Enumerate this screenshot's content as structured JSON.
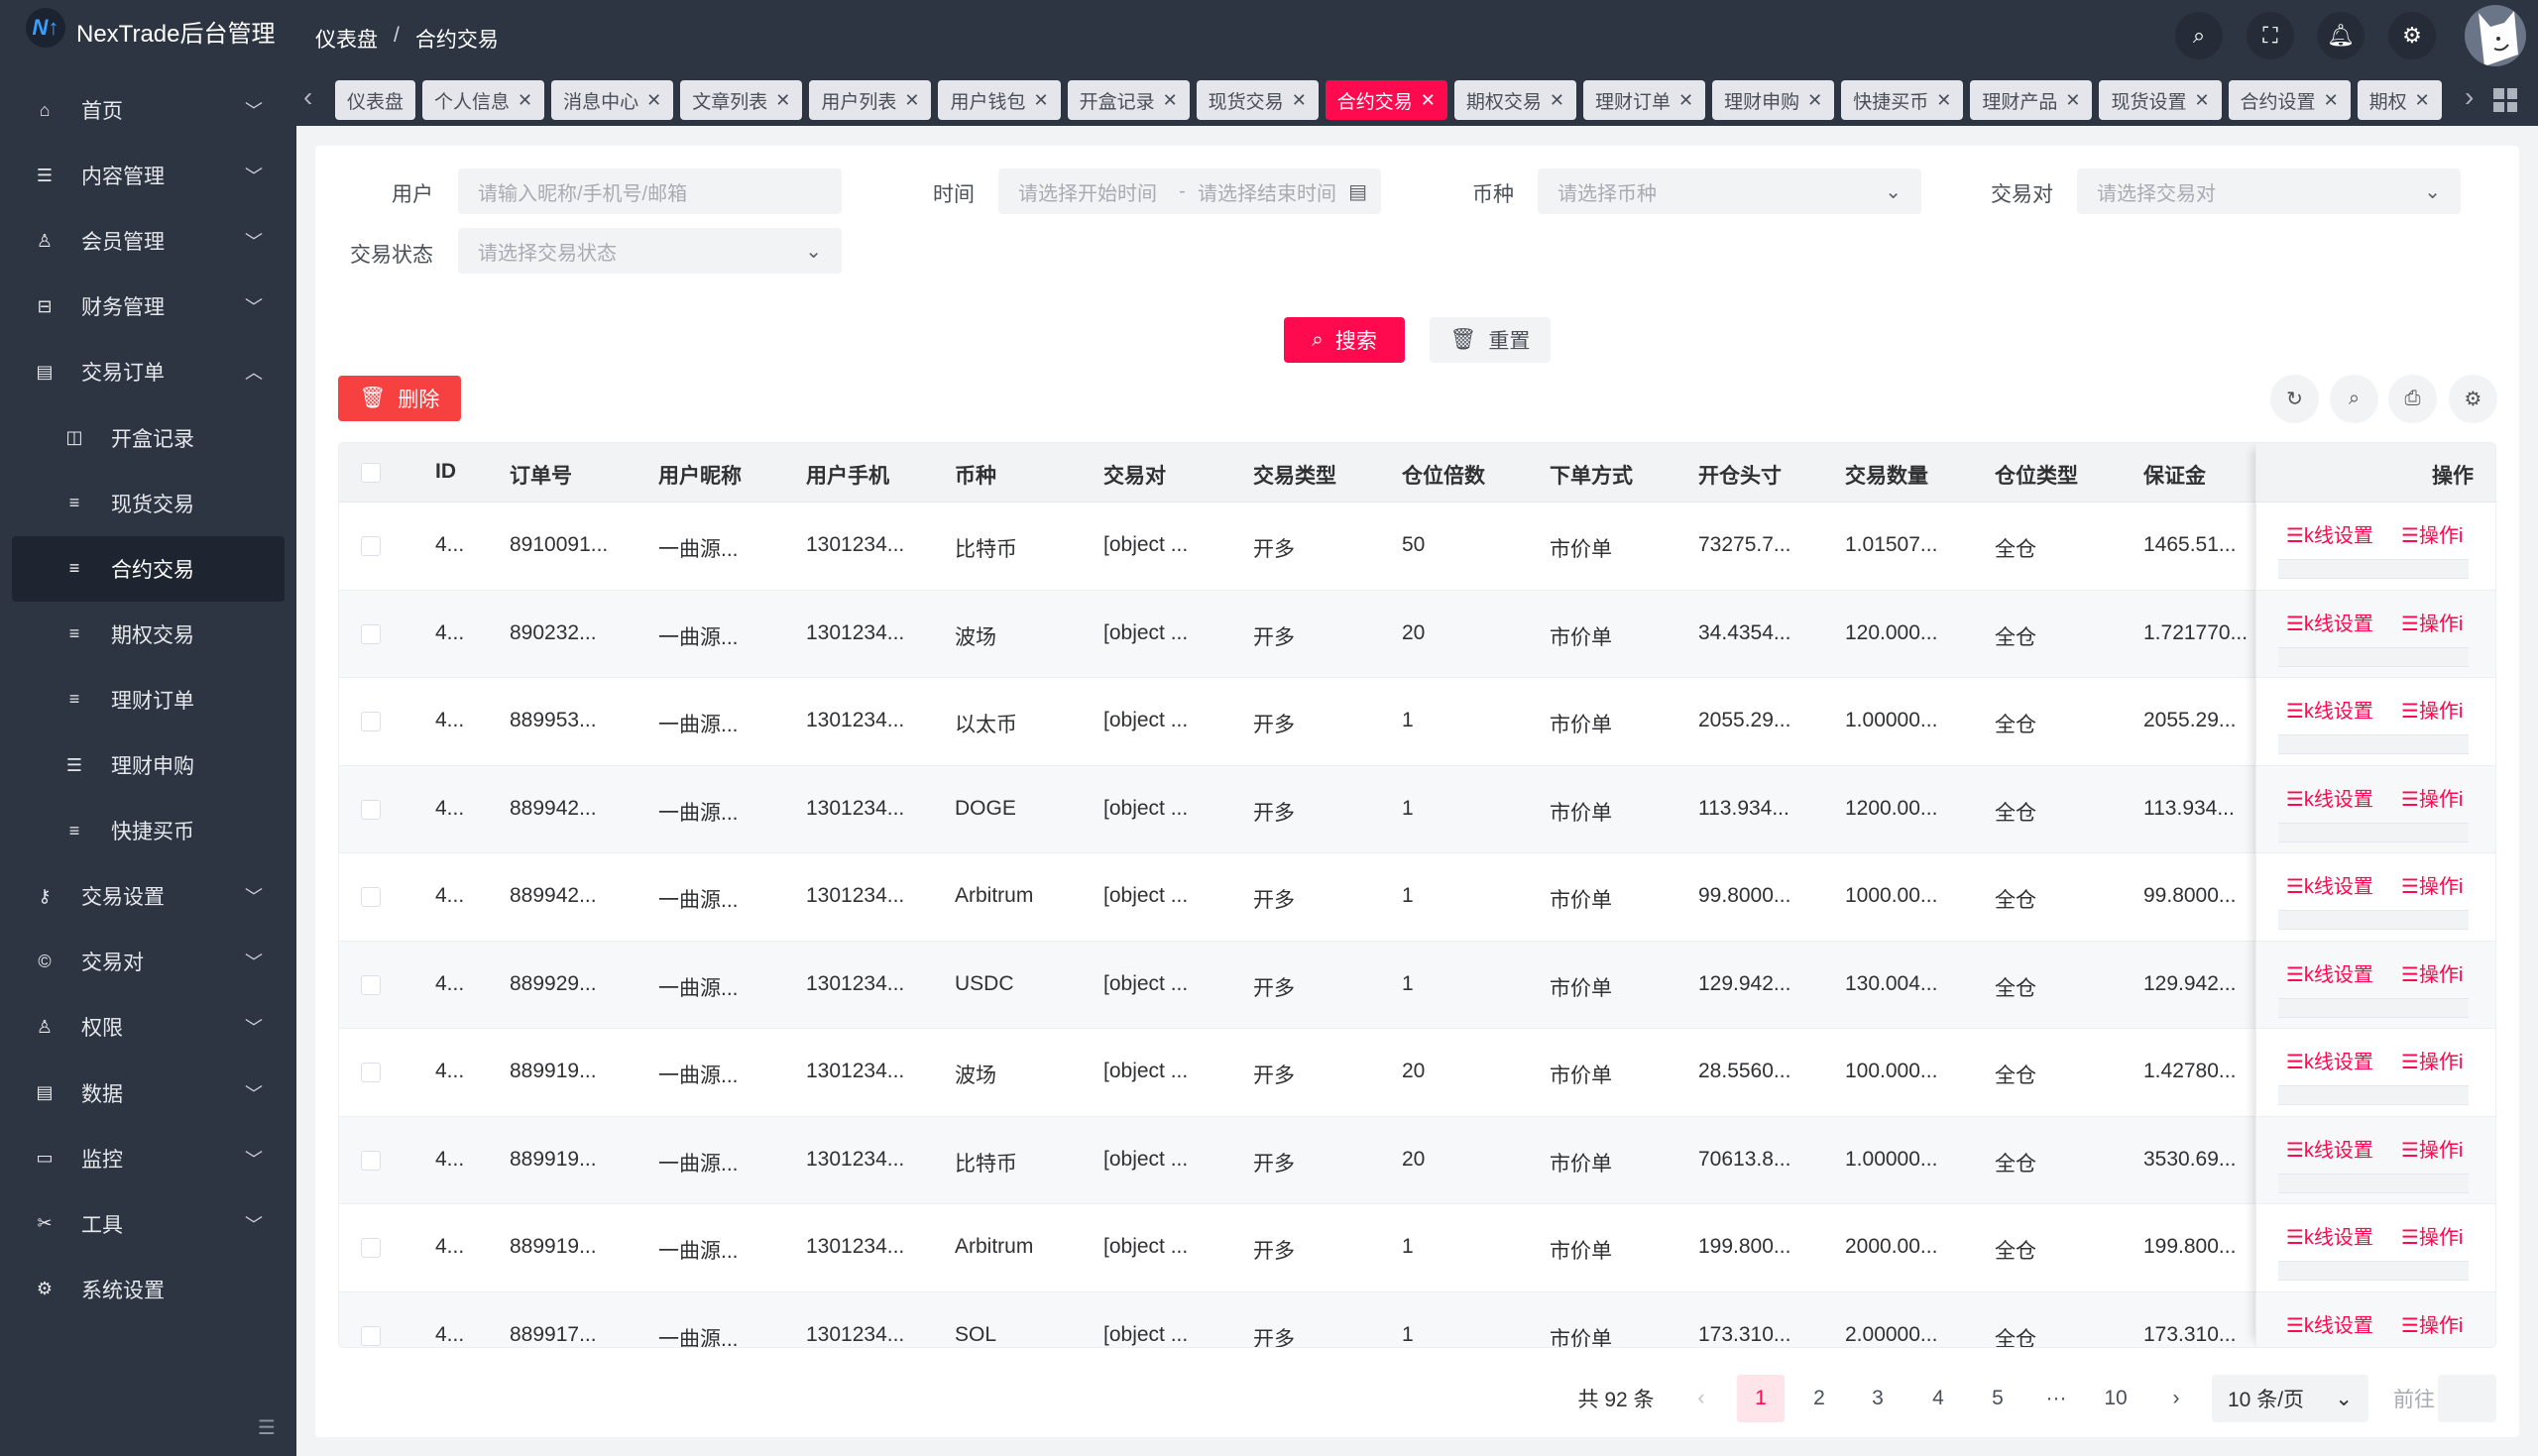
{
  "app": {
    "title": "NexTrade后台管理",
    "logo_text": "NT"
  },
  "breadcrumb": [
    "仪表盘",
    "合约交易"
  ],
  "header_icons": [
    "search-icon",
    "fullscreen-icon",
    "bell-icon",
    "gear-icon"
  ],
  "sidebar": {
    "items": [
      {
        "label": "首页",
        "icon": "home-icon",
        "chevron": "down"
      },
      {
        "label": "内容管理",
        "icon": "list-icon",
        "chevron": "down"
      },
      {
        "label": "会员管理",
        "icon": "user-icon",
        "chevron": "down"
      },
      {
        "label": "财务管理",
        "icon": "wallet-icon",
        "chevron": "down"
      },
      {
        "label": "交易订单",
        "icon": "table-icon",
        "chevron": "up"
      },
      {
        "label": "开盒记录",
        "icon": "box-icon",
        "sub": true
      },
      {
        "label": "现货交易",
        "icon": "menu-icon",
        "sub": true
      },
      {
        "label": "合约交易",
        "icon": "menu-icon",
        "sub": true,
        "active": true
      },
      {
        "label": "期权交易",
        "icon": "menu-icon",
        "sub": true
      },
      {
        "label": "理财订单",
        "icon": "menu-icon",
        "sub": true
      },
      {
        "label": "理财申购",
        "icon": "list-icon",
        "sub": true
      },
      {
        "label": "快捷买币",
        "icon": "align-left-icon",
        "sub": true
      },
      {
        "label": "交易设置",
        "icon": "key-icon",
        "chevron": "down"
      },
      {
        "label": "交易对",
        "icon": "coin-icon",
        "chevron": "down"
      },
      {
        "label": "权限",
        "icon": "user-lock-icon",
        "chevron": "down"
      },
      {
        "label": "数据",
        "icon": "database-icon",
        "chevron": "down"
      },
      {
        "label": "监控",
        "icon": "monitor-icon",
        "chevron": "down"
      },
      {
        "label": "工具",
        "icon": "tools-icon",
        "chevron": "down"
      },
      {
        "label": "系统设置",
        "icon": "gear-icon"
      }
    ]
  },
  "tabs": [
    {
      "label": "仪表盘",
      "closable": false
    },
    {
      "label": "个人信息",
      "closable": true
    },
    {
      "label": "消息中心",
      "closable": true
    },
    {
      "label": "文章列表",
      "closable": true
    },
    {
      "label": "用户列表",
      "closable": true
    },
    {
      "label": "用户钱包",
      "closable": true
    },
    {
      "label": "开盒记录",
      "closable": true
    },
    {
      "label": "现货交易",
      "closable": true
    },
    {
      "label": "合约交易",
      "closable": true,
      "active": true
    },
    {
      "label": "期权交易",
      "closable": true
    },
    {
      "label": "理财订单",
      "closable": true
    },
    {
      "label": "理财申购",
      "closable": true
    },
    {
      "label": "快捷买币",
      "closable": true
    },
    {
      "label": "理财产品",
      "closable": true
    },
    {
      "label": "现货设置",
      "closable": true
    },
    {
      "label": "合约设置",
      "closable": true
    },
    {
      "label": "期权",
      "closable": true
    }
  ],
  "filters": {
    "user_label": "用户",
    "user_placeholder": "请输入昵称/手机号/邮箱",
    "time_label": "时间",
    "time_start_placeholder": "请选择开始时间",
    "time_sep": "-",
    "time_end_placeholder": "请选择结束时间",
    "coin_label": "币种",
    "coin_placeholder": "请选择币种",
    "pair_label": "交易对",
    "pair_placeholder": "请选择交易对",
    "status_label": "交易状态",
    "status_placeholder": "请选择交易状态"
  },
  "buttons": {
    "search": "搜索",
    "reset": "重置",
    "delete": "删除"
  },
  "colors": {
    "accent": "#ff0a4f",
    "delete": "#f74141",
    "sidebar": "#2d3542"
  },
  "table": {
    "columns": [
      "ID",
      "订单号",
      "用户昵称",
      "用户手机",
      "币种",
      "交易对",
      "交易类型",
      "仓位倍数",
      "下单方式",
      "开仓头寸",
      "交易数量",
      "仓位类型",
      "保证金"
    ],
    "actions_header": "操作",
    "action_links": [
      "☰k线设置",
      "☰操作i"
    ],
    "rows": [
      [
        "4...",
        "8910091...",
        "一曲源...",
        "1301234...",
        "比特币",
        "[object ...",
        "开多",
        "50",
        "市价单",
        "73275.7...",
        "1.01507...",
        "全仓",
        "1465.51..."
      ],
      [
        "4...",
        "890232...",
        "一曲源...",
        "1301234...",
        "波场",
        "[object ...",
        "开多",
        "20",
        "市价单",
        "34.4354...",
        "120.000...",
        "全仓",
        "1.721770..."
      ],
      [
        "4...",
        "889953...",
        "一曲源...",
        "1301234...",
        "以太币",
        "[object ...",
        "开多",
        "1",
        "市价单",
        "2055.29...",
        "1.00000...",
        "全仓",
        "2055.29..."
      ],
      [
        "4...",
        "889942...",
        "一曲源...",
        "1301234...",
        "DOGE",
        "[object ...",
        "开多",
        "1",
        "市价单",
        "113.934...",
        "1200.00...",
        "全仓",
        "113.934..."
      ],
      [
        "4...",
        "889942...",
        "一曲源...",
        "1301234...",
        "Arbitrum",
        "[object ...",
        "开多",
        "1",
        "市价单",
        "99.8000...",
        "1000.00...",
        "全仓",
        "99.8000..."
      ],
      [
        "4...",
        "889929...",
        "一曲源...",
        "1301234...",
        "USDC",
        "[object ...",
        "开多",
        "1",
        "市价单",
        "129.942...",
        "130.004...",
        "全仓",
        "129.942..."
      ],
      [
        "4...",
        "889919...",
        "一曲源...",
        "1301234...",
        "波场",
        "[object ...",
        "开多",
        "20",
        "市价单",
        "28.5560...",
        "100.000...",
        "全仓",
        "1.42780..."
      ],
      [
        "4...",
        "889919...",
        "一曲源...",
        "1301234...",
        "比特币",
        "[object ...",
        "开多",
        "20",
        "市价单",
        "70613.8...",
        "1.00000...",
        "全仓",
        "3530.69..."
      ],
      [
        "4...",
        "889919...",
        "一曲源...",
        "1301234...",
        "Arbitrum",
        "[object ...",
        "开多",
        "1",
        "市价单",
        "199.800...",
        "2000.00...",
        "全仓",
        "199.800..."
      ],
      [
        "4...",
        "889917...",
        "一曲源...",
        "1301234...",
        "SOL",
        "[object ...",
        "开多",
        "1",
        "市价单",
        "173.310...",
        "2.00000...",
        "全仓",
        "173.310..."
      ]
    ]
  },
  "pagination": {
    "total": "共 92 条",
    "pages": [
      "1",
      "2",
      "3",
      "4",
      "5",
      "···",
      "10"
    ],
    "current": "1",
    "page_size": "10 条/页",
    "goto_label": "前往",
    "goto_value": ""
  }
}
